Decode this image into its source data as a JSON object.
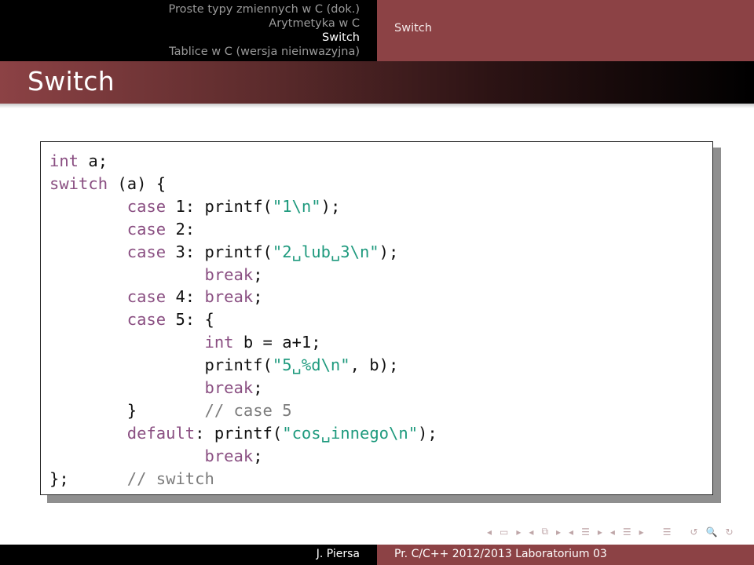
{
  "header": {
    "sections": [
      {
        "label": "Proste typy zmiennych w C (dok.)",
        "active": false
      },
      {
        "label": "Arytmetyka w C",
        "active": false
      },
      {
        "label": "Switch",
        "active": true
      },
      {
        "label": "Tablice w C (wersja nieinwazyjna)",
        "active": false
      }
    ],
    "subsection": "Switch"
  },
  "frame": {
    "title": "Switch"
  },
  "code": {
    "lines": [
      [
        {
          "t": "int",
          "c": "kw"
        },
        {
          "t": " a;",
          "c": ""
        }
      ],
      [
        {
          "t": "switch",
          "c": "kw"
        },
        {
          "t": " (a) {",
          "c": ""
        }
      ],
      [
        {
          "t": "        ",
          "c": ""
        },
        {
          "t": "case",
          "c": "kw"
        },
        {
          "t": " 1: printf(",
          "c": ""
        },
        {
          "t": "\"1\\n\"",
          "c": "str"
        },
        {
          "t": ");",
          "c": ""
        }
      ],
      [
        {
          "t": "        ",
          "c": ""
        },
        {
          "t": "case",
          "c": "kw"
        },
        {
          "t": " 2:",
          "c": ""
        }
      ],
      [
        {
          "t": "        ",
          "c": ""
        },
        {
          "t": "case",
          "c": "kw"
        },
        {
          "t": " 3: printf(",
          "c": ""
        },
        {
          "t": "\"2␣lub␣3\\n\"",
          "c": "str"
        },
        {
          "t": ");",
          "c": ""
        }
      ],
      [
        {
          "t": "                ",
          "c": ""
        },
        {
          "t": "break",
          "c": "kw"
        },
        {
          "t": ";",
          "c": ""
        }
      ],
      [
        {
          "t": "        ",
          "c": ""
        },
        {
          "t": "case",
          "c": "kw"
        },
        {
          "t": " 4: ",
          "c": ""
        },
        {
          "t": "break",
          "c": "kw"
        },
        {
          "t": ";",
          "c": ""
        }
      ],
      [
        {
          "t": "        ",
          "c": ""
        },
        {
          "t": "case",
          "c": "kw"
        },
        {
          "t": " 5: {",
          "c": ""
        }
      ],
      [
        {
          "t": "                ",
          "c": ""
        },
        {
          "t": "int",
          "c": "kw"
        },
        {
          "t": " b = a+1;",
          "c": ""
        }
      ],
      [
        {
          "t": "                printf(",
          "c": ""
        },
        {
          "t": "\"5␣%d\\n\"",
          "c": "str"
        },
        {
          "t": ", b);",
          "c": ""
        }
      ],
      [
        {
          "t": "                ",
          "c": ""
        },
        {
          "t": "break",
          "c": "kw"
        },
        {
          "t": ";",
          "c": ""
        }
      ],
      [
        {
          "t": "        }       ",
          "c": ""
        },
        {
          "t": "// case 5",
          "c": "cm"
        }
      ],
      [
        {
          "t": "        ",
          "c": ""
        },
        {
          "t": "default",
          "c": "kw"
        },
        {
          "t": ": printf(",
          "c": ""
        },
        {
          "t": "\"cos␣innego\\n\"",
          "c": "str"
        },
        {
          "t": ");",
          "c": ""
        }
      ],
      [
        {
          "t": "                ",
          "c": ""
        },
        {
          "t": "break",
          "c": "kw"
        },
        {
          "t": ";",
          "c": ""
        }
      ],
      [
        {
          "t": "};      ",
          "c": ""
        },
        {
          "t": "// switch",
          "c": "cm"
        }
      ]
    ]
  },
  "navigation": {
    "icons": [
      "nav-left-arrow",
      "frame-icon",
      "nav-right-arrow",
      "nav-left-arrow",
      "subsection-icon",
      "nav-right-arrow",
      "nav-left-arrow",
      "section-icon",
      "nav-right-arrow",
      "nav-left-arrow",
      "presentation-icon",
      "nav-right-arrow",
      "toc-icon",
      "back-icon",
      "search-icon",
      "forward-icon"
    ],
    "glyphs": [
      "◂",
      "▭",
      "▸",
      "◂",
      "⧉",
      "▸",
      "◂",
      "☰",
      "▸",
      "◂",
      "☰",
      "▸",
      "☰",
      "↺",
      "🔍",
      "↻"
    ]
  },
  "footer": {
    "author": "J. Piersa",
    "title": "Pr. C/C++ 2012/2013 Laboratorium 03"
  },
  "colors": {
    "accent": "#8c4245",
    "keyword": "#8a4f82",
    "string": "#1f9a7e",
    "comment": "#7c7c7c"
  }
}
